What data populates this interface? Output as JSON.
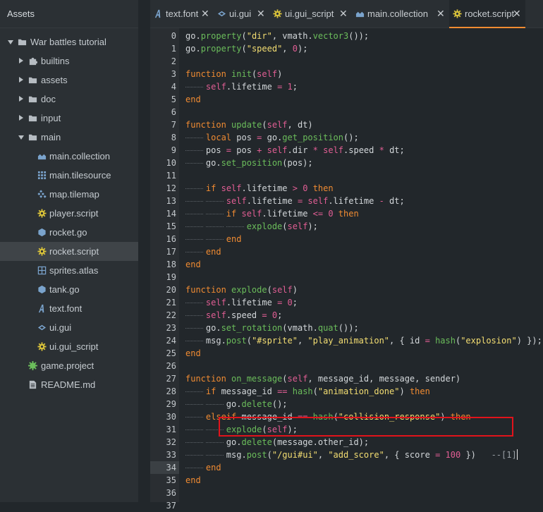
{
  "sidebar": {
    "title": "Assets",
    "items": [
      {
        "label": "War battles tutorial",
        "arrow": "down",
        "icon": "folder-icon",
        "indent": 0
      },
      {
        "label": "builtins",
        "arrow": "right",
        "icon": "puzzle-icon",
        "indent": 1
      },
      {
        "label": "assets",
        "arrow": "right",
        "icon": "folder-icon",
        "indent": 1
      },
      {
        "label": "doc",
        "arrow": "right",
        "icon": "folder-icon",
        "indent": 1
      },
      {
        "label": "input",
        "arrow": "right",
        "icon": "folder-icon",
        "indent": 1
      },
      {
        "label": "main",
        "arrow": "down",
        "icon": "folder-icon",
        "indent": 1
      },
      {
        "label": "main.collection",
        "arrow": "",
        "icon": "collection-icon",
        "indent": 2
      },
      {
        "label": "main.tilesource",
        "arrow": "",
        "icon": "tilesource-icon",
        "indent": 2
      },
      {
        "label": "map.tilemap",
        "arrow": "",
        "icon": "tilemap-icon",
        "indent": 2
      },
      {
        "label": "player.script",
        "arrow": "",
        "icon": "script-gear-icon",
        "indent": 2
      },
      {
        "label": "rocket.go",
        "arrow": "",
        "icon": "gameobject-icon",
        "indent": 2
      },
      {
        "label": "rocket.script",
        "arrow": "",
        "icon": "script-gear-icon",
        "indent": 2,
        "selected": true
      },
      {
        "label": "sprites.atlas",
        "arrow": "",
        "icon": "atlas-icon",
        "indent": 2
      },
      {
        "label": "tank.go",
        "arrow": "",
        "icon": "gameobject-icon",
        "indent": 2
      },
      {
        "label": "text.font",
        "arrow": "",
        "icon": "font-icon",
        "indent": 2
      },
      {
        "label": "ui.gui",
        "arrow": "",
        "icon": "gui-icon",
        "indent": 2
      },
      {
        "label": "ui.gui_script",
        "arrow": "",
        "icon": "script-gear-icon",
        "indent": 2
      },
      {
        "label": "game.project",
        "arrow": "",
        "icon": "project-icon",
        "indent": 1
      },
      {
        "label": "README.md",
        "arrow": "",
        "icon": "document-icon",
        "indent": 1
      }
    ]
  },
  "tabs": [
    {
      "label": "text.font",
      "icon": "font-icon",
      "active": false
    },
    {
      "label": "ui.gui",
      "icon": "gui-icon",
      "active": false
    },
    {
      "label": "ui.gui_script",
      "icon": "script-gear-icon",
      "active": false
    },
    {
      "label": "main.collection",
      "icon": "collection-icon",
      "active": false
    },
    {
      "label": "rocket.script",
      "icon": "script-gear-icon",
      "active": true
    }
  ],
  "close_glyph": "✕",
  "editor": {
    "current_line": "34",
    "line_numbers": [
      "0",
      "1",
      "2",
      "3",
      "4",
      "5",
      "6",
      "7",
      "8",
      "9",
      "10",
      "11",
      "12",
      "13",
      "14",
      "15",
      "16",
      "17",
      "18",
      "19",
      "20",
      "21",
      "22",
      "23",
      "24",
      "25",
      "26",
      "27",
      "28",
      "29",
      "30",
      "31",
      "32",
      "33",
      "34",
      "35",
      "36",
      "37"
    ],
    "lines": [
      "go.property(\"dir\", vmath.vector3());",
      "go.property(\"speed\", 0);",
      "",
      "function init(self)",
      "    self.lifetime = 1;",
      "end",
      "",
      "function update(self, dt)",
      "    local pos = go.get_position();",
      "    pos = pos + self.dir * self.speed * dt;",
      "    go.set_position(pos);",
      "",
      "    if self.lifetime > 0 then",
      "        self.lifetime = self.lifetime - dt;",
      "        if self.lifetime <= 0 then",
      "            explode(self);",
      "        end",
      "    end",
      "end",
      "",
      "function explode(self)",
      "    self.lifetime = 0;",
      "    self.speed = 0;",
      "    go.set_rotation(vmath.quat());",
      "    msg.post(\"#sprite\", \"play_animation\", { id = hash(\"explosion\") });",
      "end",
      "",
      "function on_message(self, message_id, message, sender)",
      "    if message_id == hash(\"animation_done\") then",
      "        go.delete();",
      "    elseif message_id == hash(\"collision_response\") then",
      "        explode(self);",
      "        go.delete(message.other_id);",
      "        msg.post(\"/gui#ui\", \"add_score\", { score = 100 })   --[1]",
      "    end",
      "end",
      "",
      ""
    ]
  },
  "colors": {
    "keyword": "#f08b32",
    "string": "#f4de72",
    "number": "#e15e94",
    "function": "#6bbd5b",
    "highlight_border": "#e1131b",
    "tab_underline": "#f08b32"
  }
}
